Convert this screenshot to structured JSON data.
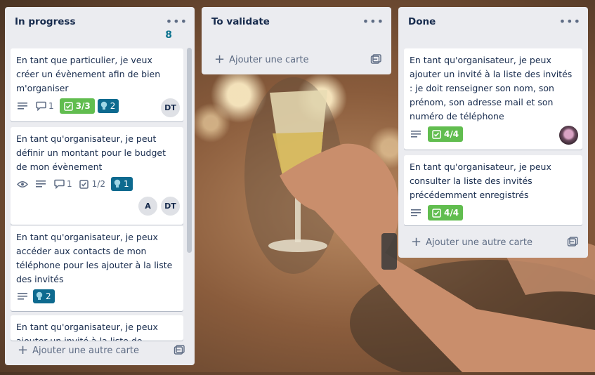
{
  "colors": {
    "list_bg": "#ebecf0",
    "card_bg": "#ffffff",
    "checklist_done": "#61bd4f",
    "plugin_badge": "#0e6a8f",
    "count_accent": "#0e7490"
  },
  "icons": {
    "list_menu": "ellipsis-icon",
    "description": "description-icon",
    "comments": "comment-icon",
    "checklist": "checklist-icon",
    "watch": "eye-icon",
    "plugin": "bulb-icon",
    "add": "plus-icon",
    "template": "template-icon"
  },
  "lists": [
    {
      "title": "In progress",
      "count": "8",
      "add_label": "Ajouter une autre carte",
      "cards": [
        {
          "title": "En tant que particulier, je veux créer un évènement afin de bien m'organiser",
          "comments": "1",
          "checklist": "3/3",
          "plugin": "2",
          "members": [
            "DT"
          ]
        },
        {
          "title": "En tant qu'organisateur, je peut définir un montant pour le budget de mon évènement",
          "comments": "1",
          "checklist": "1/2",
          "plugin": "1",
          "members": [
            "A",
            "DT"
          ]
        },
        {
          "title": "En tant qu'organisateur, je peux accéder aux contacts de mon téléphone pour les ajouter à la liste des invités",
          "plugin": "2"
        },
        {
          "title": "En tant qu'organisateur, je peux ajouter un invité à la liste de l'évènement"
        }
      ]
    },
    {
      "title": "To validate",
      "add_label": "Ajouter une carte"
    },
    {
      "title": "Done",
      "add_label": "Ajouter une autre carte",
      "cards": [
        {
          "title": "En tant qu'organisateur, je peux ajouter un invité à la liste des invités : je doit renseigner son nom, son prénom, son adresse mail et son numéro de téléphone",
          "checklist": "4/4"
        },
        {
          "title": "En tant qu'organisateur, je peux consulter la liste des invités précédemment enregistrés",
          "checklist": "4/4"
        }
      ]
    }
  ]
}
